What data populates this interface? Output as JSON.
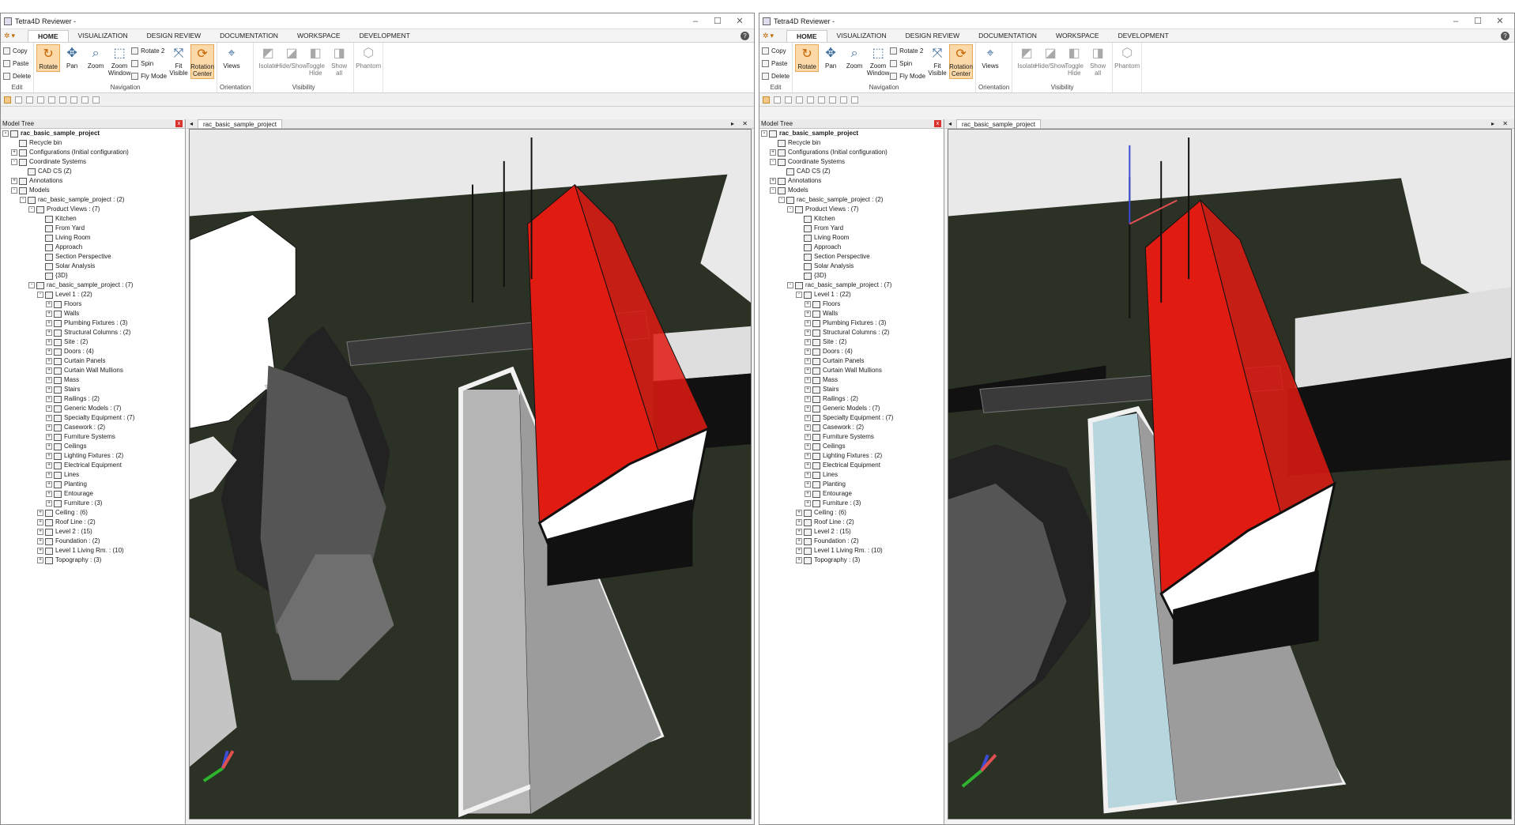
{
  "app": {
    "title": "Tetra4D Reviewer -",
    "window_controls": [
      "–",
      "☐",
      "✕"
    ]
  },
  "tabs": [
    "HOME",
    "VISUALIZATION",
    "DESIGN REVIEW",
    "DOCUMENTATION",
    "WORKSPACE",
    "DEVELOPMENT"
  ],
  "help_label": "?",
  "ribbon": {
    "edit": {
      "label": "Edit",
      "copy": "Copy",
      "paste": "Paste",
      "delete": "Delete"
    },
    "navigation": {
      "label": "Navigation",
      "rotate": "Rotate",
      "pan": "Pan",
      "zoom": "Zoom",
      "zoom_window": "Zoom Window",
      "rotate2": "Rotate 2",
      "spin": "Spin",
      "fly_mode": "Fly Mode",
      "fit_visible": "Fit Visible",
      "rotation_center": "Rotation Center"
    },
    "orientation": {
      "label": "Orientation",
      "views": "Views"
    },
    "visibility": {
      "label": "Visibility",
      "isolate": "Isolate",
      "hide_show": "Hide/Show",
      "toggle_hide": "Toggle Hide",
      "show_all": "Show all",
      "phantom": "Phantom"
    }
  },
  "model_tree": {
    "title": "Model Tree",
    "close": "x",
    "nodes": [
      {
        "label": "rac_basic_sample_project",
        "level": 0,
        "toggle": "-",
        "bold": true
      },
      {
        "label": "Recycle bin",
        "level": 1,
        "toggle": ""
      },
      {
        "label": "Configurations (Initial configuration)",
        "level": 1,
        "toggle": "+"
      },
      {
        "label": "Coordinate Systems",
        "level": 1,
        "toggle": "-"
      },
      {
        "label": "CAD CS (Z)",
        "level": 2,
        "toggle": ""
      },
      {
        "label": "Annotations",
        "level": 1,
        "toggle": "+"
      },
      {
        "label": "Models",
        "level": 1,
        "toggle": "-"
      },
      {
        "label": "rac_basic_sample_project : (2)",
        "level": 2,
        "toggle": "-"
      },
      {
        "label": "Product Views : (7)",
        "level": 3,
        "toggle": "-"
      },
      {
        "label": "Kitchen",
        "level": 4,
        "toggle": ""
      },
      {
        "label": "From Yard",
        "level": 4,
        "toggle": ""
      },
      {
        "label": "Living Room",
        "level": 4,
        "toggle": ""
      },
      {
        "label": "Approach",
        "level": 4,
        "toggle": ""
      },
      {
        "label": "Section Perspective",
        "level": 4,
        "toggle": ""
      },
      {
        "label": "Solar Analysis",
        "level": 4,
        "toggle": ""
      },
      {
        "label": "{3D}",
        "level": 4,
        "toggle": ""
      },
      {
        "label": "rac_basic_sample_project : (7)",
        "level": 3,
        "toggle": "-"
      },
      {
        "label": "Level 1 : (22)",
        "level": 4,
        "toggle": "-"
      },
      {
        "label": "Floors",
        "level": 5,
        "toggle": "+"
      },
      {
        "label": "Walls",
        "level": 5,
        "toggle": "+"
      },
      {
        "label": "Plumbing Fixtures : (3)",
        "level": 5,
        "toggle": "+"
      },
      {
        "label": "Structural Columns : (2)",
        "level": 5,
        "toggle": "+"
      },
      {
        "label": "Site : (2)",
        "level": 5,
        "toggle": "+"
      },
      {
        "label": "Doors : (4)",
        "level": 5,
        "toggle": "+"
      },
      {
        "label": "Curtain Panels",
        "level": 5,
        "toggle": "+"
      },
      {
        "label": "Curtain Wall Mullions",
        "level": 5,
        "toggle": "+"
      },
      {
        "label": "Mass",
        "level": 5,
        "toggle": "+"
      },
      {
        "label": "Stairs",
        "level": 5,
        "toggle": "+"
      },
      {
        "label": "Railings : (2)",
        "level": 5,
        "toggle": "+"
      },
      {
        "label": "Generic Models : (7)",
        "level": 5,
        "toggle": "+"
      },
      {
        "label": "Specialty Equipment : (7)",
        "level": 5,
        "toggle": "+"
      },
      {
        "label": "Casework : (2)",
        "level": 5,
        "toggle": "+"
      },
      {
        "label": "Furniture Systems",
        "level": 5,
        "toggle": "+"
      },
      {
        "label": "Ceilings",
        "level": 5,
        "toggle": "+"
      },
      {
        "label": "Lighting Fixtures : (2)",
        "level": 5,
        "toggle": "+"
      },
      {
        "label": "Electrical Equipment",
        "level": 5,
        "toggle": "+"
      },
      {
        "label": "Lines",
        "level": 5,
        "toggle": "+"
      },
      {
        "label": "Planting",
        "level": 5,
        "toggle": "+"
      },
      {
        "label": "Entourage",
        "level": 5,
        "toggle": "+"
      },
      {
        "label": "Furniture : (3)",
        "level": 5,
        "toggle": "+"
      },
      {
        "label": "Ceiling : (6)",
        "level": 4,
        "toggle": "+"
      },
      {
        "label": "Roof Line : (2)",
        "level": 4,
        "toggle": "+"
      },
      {
        "label": "Level 2 : (15)",
        "level": 4,
        "toggle": "+"
      },
      {
        "label": "Foundation : (2)",
        "level": 4,
        "toggle": "+"
      },
      {
        "label": "Level 1 Living Rm. : (10)",
        "level": 4,
        "toggle": "+"
      },
      {
        "label": "Topography : (3)",
        "level": 4,
        "toggle": "+"
      }
    ]
  },
  "viewport": {
    "back_arrow": "◂",
    "document_tab": "rac_basic_sample_project",
    "right_controls": "▸ ✕"
  },
  "colors": {
    "roof": "#e01b12",
    "ground": "#2b3124",
    "background": "#e9e9e9",
    "pool_selected": "#b7d6dd",
    "accent_highlight": "#fbd9a8"
  }
}
